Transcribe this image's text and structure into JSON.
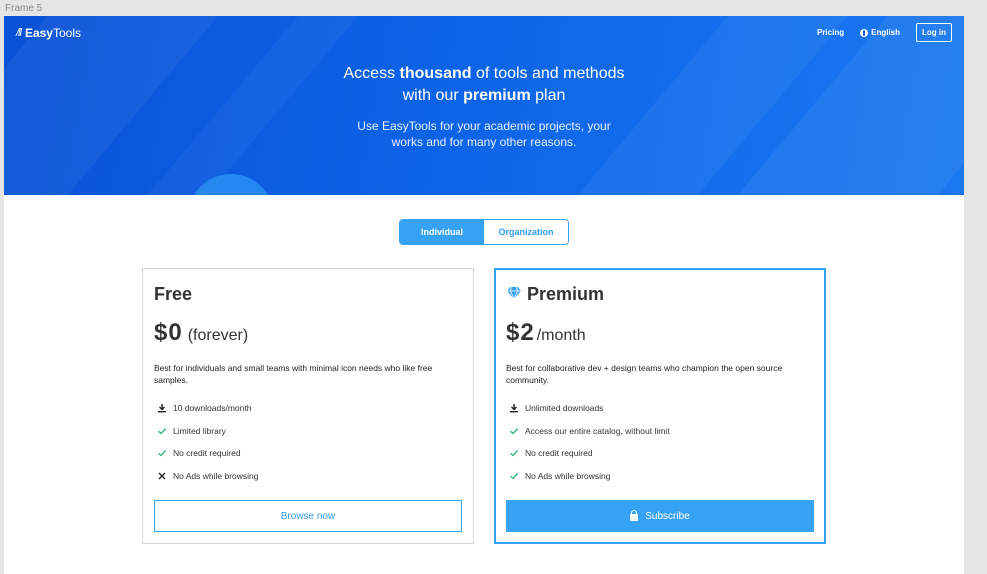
{
  "frame_label": "Frame 5",
  "header": {
    "logo_prefix": "Easy",
    "logo_suffix": "Tools",
    "logo_mark": "/ll",
    "nav": {
      "pricing": "Pricing",
      "language": "English",
      "login": "Log in"
    }
  },
  "hero": {
    "line1_pre": "Access ",
    "line1_bold": "thousand",
    "line1_post": " of tools and methods",
    "line2_pre": "with our ",
    "line2_bold": "premium",
    "line2_post": " plan",
    "sub1": "Use EasyTools for your academic projects, your",
    "sub2": "works and for many other reasons."
  },
  "toggle": {
    "individual": "Individual",
    "organization": "Organization",
    "selected": "Individual"
  },
  "plans": {
    "free": {
      "title": "Free",
      "price": "$0",
      "period": "(forever)",
      "description": "Best for individuals and small teams with minimal icon needs who like free samples.",
      "features": [
        {
          "icon": "download-icon",
          "text": "10 downloads/month"
        },
        {
          "icon": "check-icon",
          "text": "Limited library"
        },
        {
          "icon": "check-icon",
          "text": "No credit required"
        },
        {
          "icon": "cross-icon",
          "text": "No Ads while browsing"
        }
      ],
      "cta": "Browse now"
    },
    "premium": {
      "title": "Premium",
      "price": "$2",
      "period": "/month",
      "description": "Best for collaborative dev + design teams who champion the open source community.",
      "features": [
        {
          "icon": "download-icon",
          "text": "Unlimited downloads"
        },
        {
          "icon": "check-icon",
          "text": "Access our entire catalog, without limit"
        },
        {
          "icon": "check-icon",
          "text": "No credit required"
        },
        {
          "icon": "check-icon",
          "text": "No Ads while browsing"
        }
      ],
      "cta": "Subscribe"
    }
  },
  "colors": {
    "accent": "#36a2f5",
    "hero": "#0d63e8",
    "check": "#2bb673"
  }
}
